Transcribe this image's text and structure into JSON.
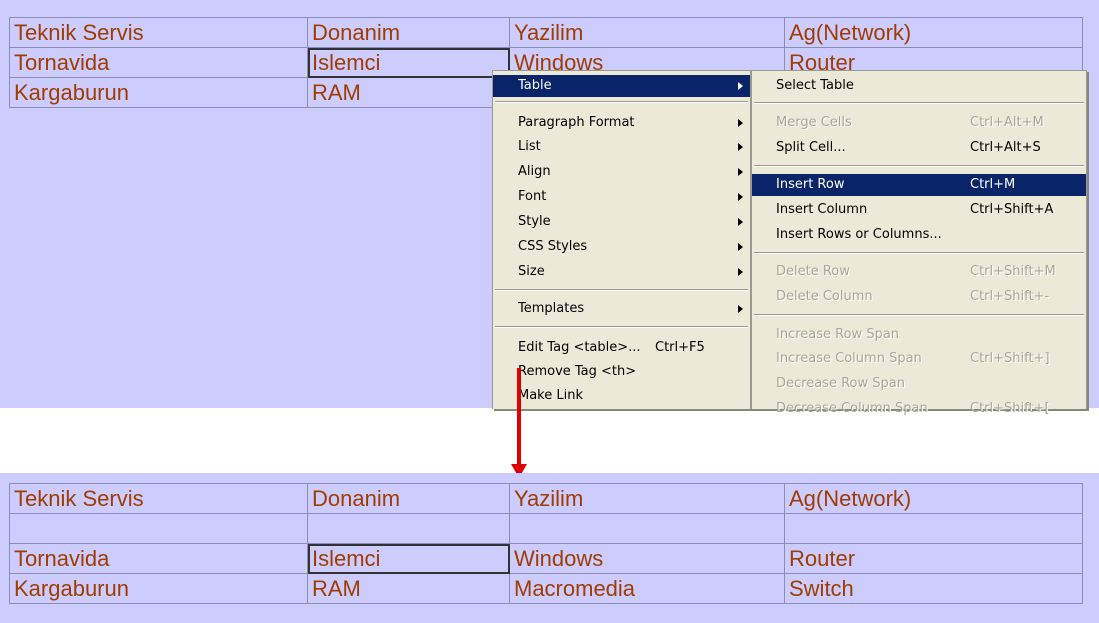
{
  "top_table": {
    "rows": [
      [
        "Teknik Servis",
        "Donanim",
        "Yazilim",
        "Ag(Network)"
      ],
      [
        "Tornavida",
        "Islemci",
        "Windows",
        "Router"
      ],
      [
        "Kargaburun",
        "RAM",
        "",
        ""
      ]
    ]
  },
  "context_menu": {
    "items": [
      {
        "label": "Table",
        "submenu": true,
        "highlighted": true
      },
      {
        "label": "Paragraph Format",
        "submenu": true
      },
      {
        "label": "List",
        "submenu": true
      },
      {
        "label": "Align",
        "submenu": true
      },
      {
        "label": "Font",
        "submenu": true
      },
      {
        "label": "Style",
        "submenu": true
      },
      {
        "label": "CSS Styles",
        "submenu": true
      },
      {
        "label": "Size",
        "submenu": true
      },
      {
        "label": "Templates",
        "submenu": true
      },
      {
        "label": "Edit Tag <table>...",
        "shortcut": "Ctrl+F5"
      },
      {
        "label": "Remove Tag <th>"
      },
      {
        "label": "Make Link"
      }
    ]
  },
  "table_submenu": {
    "items": [
      {
        "label": "Select Table",
        "shortcut": ""
      },
      {
        "label": "Merge Cells",
        "shortcut": "Ctrl+Alt+M",
        "disabled": true
      },
      {
        "label": "Split Cell...",
        "shortcut": "Ctrl+Alt+S"
      },
      {
        "label": "Insert Row",
        "shortcut": "Ctrl+M",
        "highlighted": true
      },
      {
        "label": "Insert Column",
        "shortcut": "Ctrl+Shift+A"
      },
      {
        "label": "Insert Rows or Columns...",
        "shortcut": ""
      },
      {
        "label": "Delete Row",
        "shortcut": "Ctrl+Shift+M",
        "disabled": true
      },
      {
        "label": "Delete Column",
        "shortcut": "Ctrl+Shift+-",
        "disabled": true
      },
      {
        "label": "Increase Row Span",
        "shortcut": "",
        "disabled": true
      },
      {
        "label": "Increase Column Span",
        "shortcut": "Ctrl+Shift+]",
        "disabled": true
      },
      {
        "label": "Decrease Row Span",
        "shortcut": "",
        "disabled": true
      },
      {
        "label": "Decrease Column Span",
        "shortcut": "Ctrl+Shift+[",
        "disabled": true
      }
    ]
  },
  "bottom_table": {
    "rows": [
      [
        "Teknik Servis",
        "Donanim",
        "Yazilim",
        "Ag(Network)"
      ],
      [
        "",
        "",
        "",
        ""
      ],
      [
        "Tornavida",
        "Islemci",
        "Windows",
        "Router"
      ],
      [
        "Kargaburun",
        "RAM",
        "Macromedia",
        "Switch"
      ]
    ]
  },
  "colors": {
    "panel_bg": "#ccccff",
    "cell_text": "#a03c00",
    "menu_bg": "#ece9d8",
    "highlight": "#0a246a",
    "arrow": "#e00000"
  }
}
